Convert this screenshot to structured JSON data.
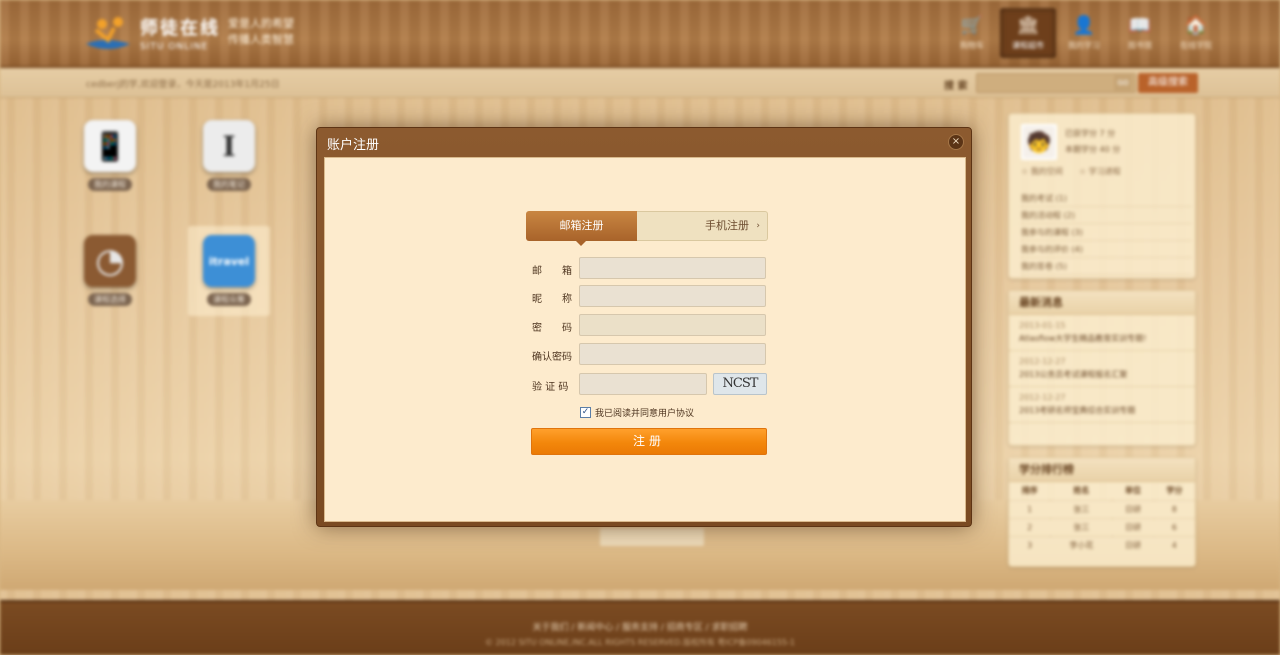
{
  "header": {
    "logo_title": "师徒在线",
    "logo_sub": "SITU ONLINE",
    "slogan": [
      "爱是人的希望",
      "传播人类智慧"
    ],
    "nav": [
      {
        "label": "购物车",
        "icon": "cart-icon",
        "glyph": "🛒"
      },
      {
        "label": "课程超市",
        "icon": "building-icon",
        "glyph": "🏛"
      },
      {
        "label": "我的学习",
        "icon": "user-icon",
        "glyph": "👤"
      },
      {
        "label": "图书馆",
        "icon": "book-icon",
        "glyph": "📖"
      },
      {
        "label": "在线学院",
        "icon": "home-icon",
        "glyph": "🏠"
      }
    ],
    "active_nav": 1
  },
  "subbar": {
    "welcome": "cedberj的学,欢迎登录，今天是2013年1月25日",
    "search_label": "搜 索",
    "search_go": "GO",
    "advanced_search": "高级搜索"
  },
  "apps": [
    {
      "label": "我的课程",
      "icon": "phone-icon",
      "glyph": "📱",
      "color": "#f2f2f2"
    },
    {
      "label": "我的笔记",
      "icon": "text-cursor-icon",
      "glyph": "I",
      "color": "#ececec"
    },
    {
      "label": "课程选择",
      "icon": "clock-icon",
      "glyph": "◔",
      "color": "#8b5a32"
    },
    {
      "label": "课程众筹",
      "icon": "travel-icon",
      "glyph": "itravel",
      "color": "#3d8fd6"
    }
  ],
  "sidebar": {
    "profile": {
      "line1": "已获学分  7  分",
      "line2": "本期学分  40  分",
      "link1": "☆ 我的空间",
      "link2": "☆ 学习进程",
      "items": [
        "我的考试    (1)",
        "我的活动程    (2)",
        "我参与的课程    (3)",
        "我参与的评价    (4)",
        "我的答卷    (5)"
      ]
    },
    "news": {
      "title": "最新消息",
      "items": [
        {
          "date": "2013-01-15",
          "title": "Atlasflow大学生精品教育实训专题!"
        },
        {
          "date": "2012-12-27",
          "title": "2013公务员考试课程报名汇聚"
        },
        {
          "date": "2012-12-27",
          "title": "2013考研名师宝典综合实训专题"
        }
      ]
    },
    "rank": {
      "title": "学分排行榜",
      "headers": [
        "排序",
        "姓名",
        "单位",
        "学分"
      ],
      "rows": [
        [
          "1",
          "张三",
          "日研",
          "8"
        ],
        [
          "2",
          "张三",
          "日研",
          "6"
        ],
        [
          "3",
          "李小花",
          "日研",
          "4"
        ]
      ]
    }
  },
  "footer": {
    "links": "关于我们 / 新闻中心 / 服务支持 / 招商专区 / 求职招聘",
    "copyright": "© 2012 SITU ONLINE,INC.ALL RIGHTS RESERVED.版权所有 粤ICP备09046155-1"
  },
  "modal": {
    "title": "账户注册",
    "close": "×",
    "tab_email": "邮箱注册",
    "tab_phone": "手机注册",
    "tab_phone_arrow": "›",
    "fields": {
      "email": {
        "label": "邮　　箱",
        "value": "",
        "placeholder": ""
      },
      "nickname": {
        "label": "昵　　称",
        "value": "",
        "placeholder": ""
      },
      "password": {
        "label": "密　　码",
        "value": "",
        "placeholder": ""
      },
      "confirm": {
        "label": "确认密码",
        "value": "",
        "placeholder": ""
      },
      "captcha": {
        "label": "验 证 码",
        "value": "",
        "placeholder": ""
      }
    },
    "captcha_text": "NCST",
    "agree_checked": "✓",
    "agree_text": "我已阅读并同意用户协议",
    "submit": "注册"
  }
}
